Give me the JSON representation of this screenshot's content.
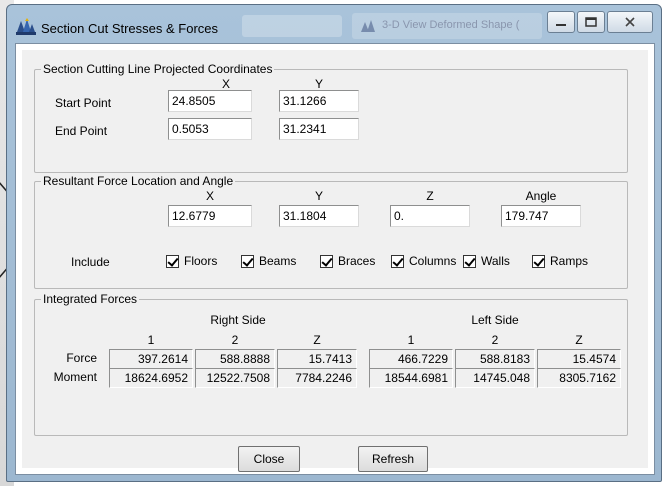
{
  "window": {
    "title": "Section Cut Stresses & Forces",
    "background_window_title": "3-D View Deformed Shape (",
    "accent": "#a9c3da"
  },
  "cutting_line": {
    "group_title": "Section Cutting Line Projected Coordinates",
    "col_x": "X",
    "col_y": "Y",
    "start_label": "Start Point",
    "start_x": "24.8505",
    "start_y": "31.1266",
    "end_label": "End Point",
    "end_x": "0.5053",
    "end_y": "31.2341"
  },
  "resultant": {
    "group_title": "Resultant Force Location and Angle",
    "col_x": "X",
    "col_y": "Y",
    "col_z": "Z",
    "col_angle": "Angle",
    "x": "12.6779",
    "y": "31.1804",
    "z": "0.",
    "angle": "179.747",
    "include_label": "Include",
    "checkboxes": [
      {
        "label": "Floors",
        "checked": true
      },
      {
        "label": "Beams",
        "checked": true
      },
      {
        "label": "Braces",
        "checked": true
      },
      {
        "label": "Columns",
        "checked": true
      },
      {
        "label": "Walls",
        "checked": true
      },
      {
        "label": "Ramps",
        "checked": true
      }
    ]
  },
  "integrated": {
    "group_title": "Integrated Forces",
    "right_side": "Right Side",
    "left_side": "Left Side",
    "columns": [
      "1",
      "2",
      "Z",
      "1",
      "2",
      "Z"
    ],
    "rows": [
      {
        "label": "Force",
        "values": [
          "397.2614",
          "588.8888",
          "15.7413",
          "466.7229",
          "588.8183",
          "15.4574"
        ]
      },
      {
        "label": "Moment",
        "values": [
          "18624.6952",
          "12522.7508",
          "7784.2246",
          "18544.6981",
          "14745.048",
          "8305.7162"
        ]
      }
    ]
  },
  "buttons": {
    "close": "Close",
    "refresh": "Refresh"
  }
}
